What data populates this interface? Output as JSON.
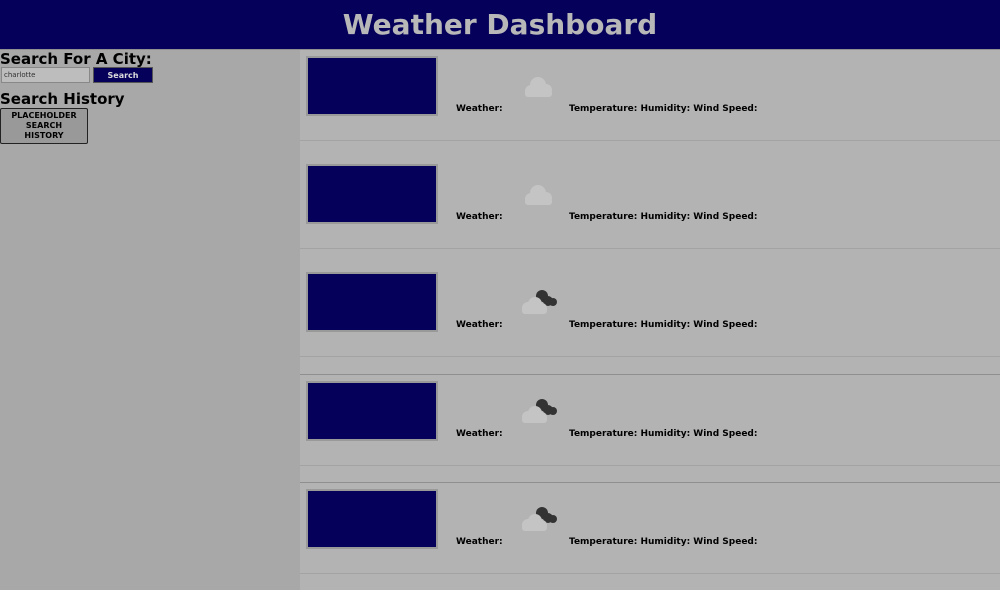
{
  "header": {
    "title": "Weather Dashboard"
  },
  "sidebar": {
    "search_heading": "Search For A City:",
    "search_value": "charlotte",
    "search_button": "Search",
    "history_heading": "Search History",
    "history_items": [
      "PLACEHOLDER\nSEARCH\nHISTORY"
    ]
  },
  "forecast": [
    {
      "weather_label": "Weather:",
      "stats_label": "Temperature: Humidity: Wind Speed:",
      "icon": "light-cloud-icon"
    },
    {
      "weather_label": "Weather:",
      "stats_label": "Temperature: Humidity: Wind Speed:",
      "icon": "light-cloud-icon"
    },
    {
      "weather_label": "Weather:",
      "stats_label": "Temperature: Humidity: Wind Speed:",
      "icon": "broken-clouds-icon"
    },
    {
      "weather_label": "Weather:",
      "stats_label": "Temperature: Humidity: Wind Speed:",
      "icon": "broken-clouds-icon"
    },
    {
      "weather_label": "Weather:",
      "stats_label": "Temperature: Humidity: Wind Speed:",
      "icon": "broken-clouds-icon"
    }
  ],
  "colors": {
    "header_bg": "#05005a",
    "page_bg": "#b3b3b3",
    "sidebar_bg": "#a8a8a8",
    "title_text": "#b8b8b8"
  }
}
